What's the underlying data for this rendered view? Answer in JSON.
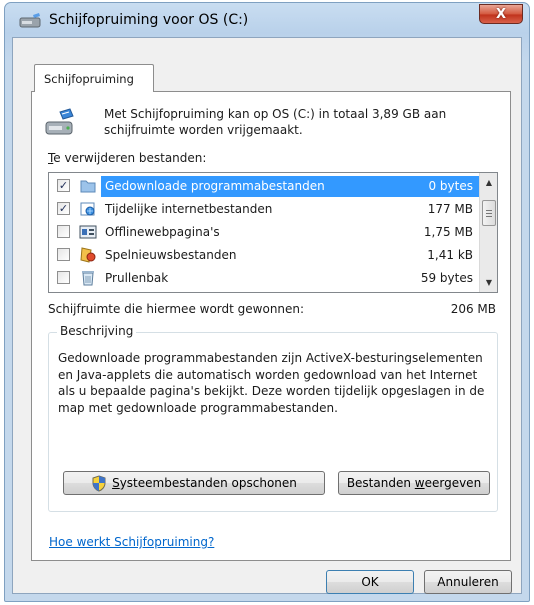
{
  "window": {
    "title": "Schijfopruiming voor OS (C:)",
    "close_glyph": "X",
    "title_icon": "disk-cleanup-icon"
  },
  "tab": {
    "label": "Schijfopruiming"
  },
  "intro": {
    "icon": "disk-cleanup-icon",
    "text": "Met Schijfopruiming kan op OS (C:) in totaal 3,89 GB aan schijfruimte worden vrijgemaakt."
  },
  "files_list": {
    "label_prefix": "T",
    "label_rest": "e verwijderen bestanden:",
    "items": [
      {
        "name": "Gedownloade programmabestanden",
        "size": "0 bytes",
        "checked": true,
        "selected": true,
        "icon": "folder-icon"
      },
      {
        "name": "Tijdelijke internetbestanden",
        "size": "177 MB",
        "checked": true,
        "selected": false,
        "icon": "internet-files-icon"
      },
      {
        "name": "Offlinewebpagina's",
        "size": "1,75 MB",
        "checked": false,
        "selected": false,
        "icon": "offline-pages-icon"
      },
      {
        "name": "Spelnieuwsbestanden",
        "size": "1,41 kB",
        "checked": false,
        "selected": false,
        "icon": "game-news-icon"
      },
      {
        "name": "Prullenbak",
        "size": "59 bytes",
        "checked": false,
        "selected": false,
        "icon": "recycle-bin-icon"
      }
    ]
  },
  "gain": {
    "label": "Schijfruimte die hiermee wordt gewonnen:",
    "value": "206 MB"
  },
  "description": {
    "legend": "Beschrijving",
    "text": "Gedownloade programmabestanden zijn ActiveX-besturingselementen en Java-applets die automatisch worden gedownload van het Internet als u bepaalde pagina's bekijkt. Deze worden tijdelijk opgeslagen in de map met gedownloade programmabestanden."
  },
  "buttons": {
    "cleanup_prefix": "S",
    "cleanup_rest": "ysteembestanden opschonen",
    "view_part1": "Bestanden ",
    "view_underline": "w",
    "view_part2": "eergeven",
    "ok": "OK",
    "cancel": "Annuleren"
  },
  "help_link": "Hoe werkt Schijfopruiming?",
  "colors": {
    "selection": "#3399ff",
    "link": "#0066cc",
    "close_button": "#c0331c"
  }
}
